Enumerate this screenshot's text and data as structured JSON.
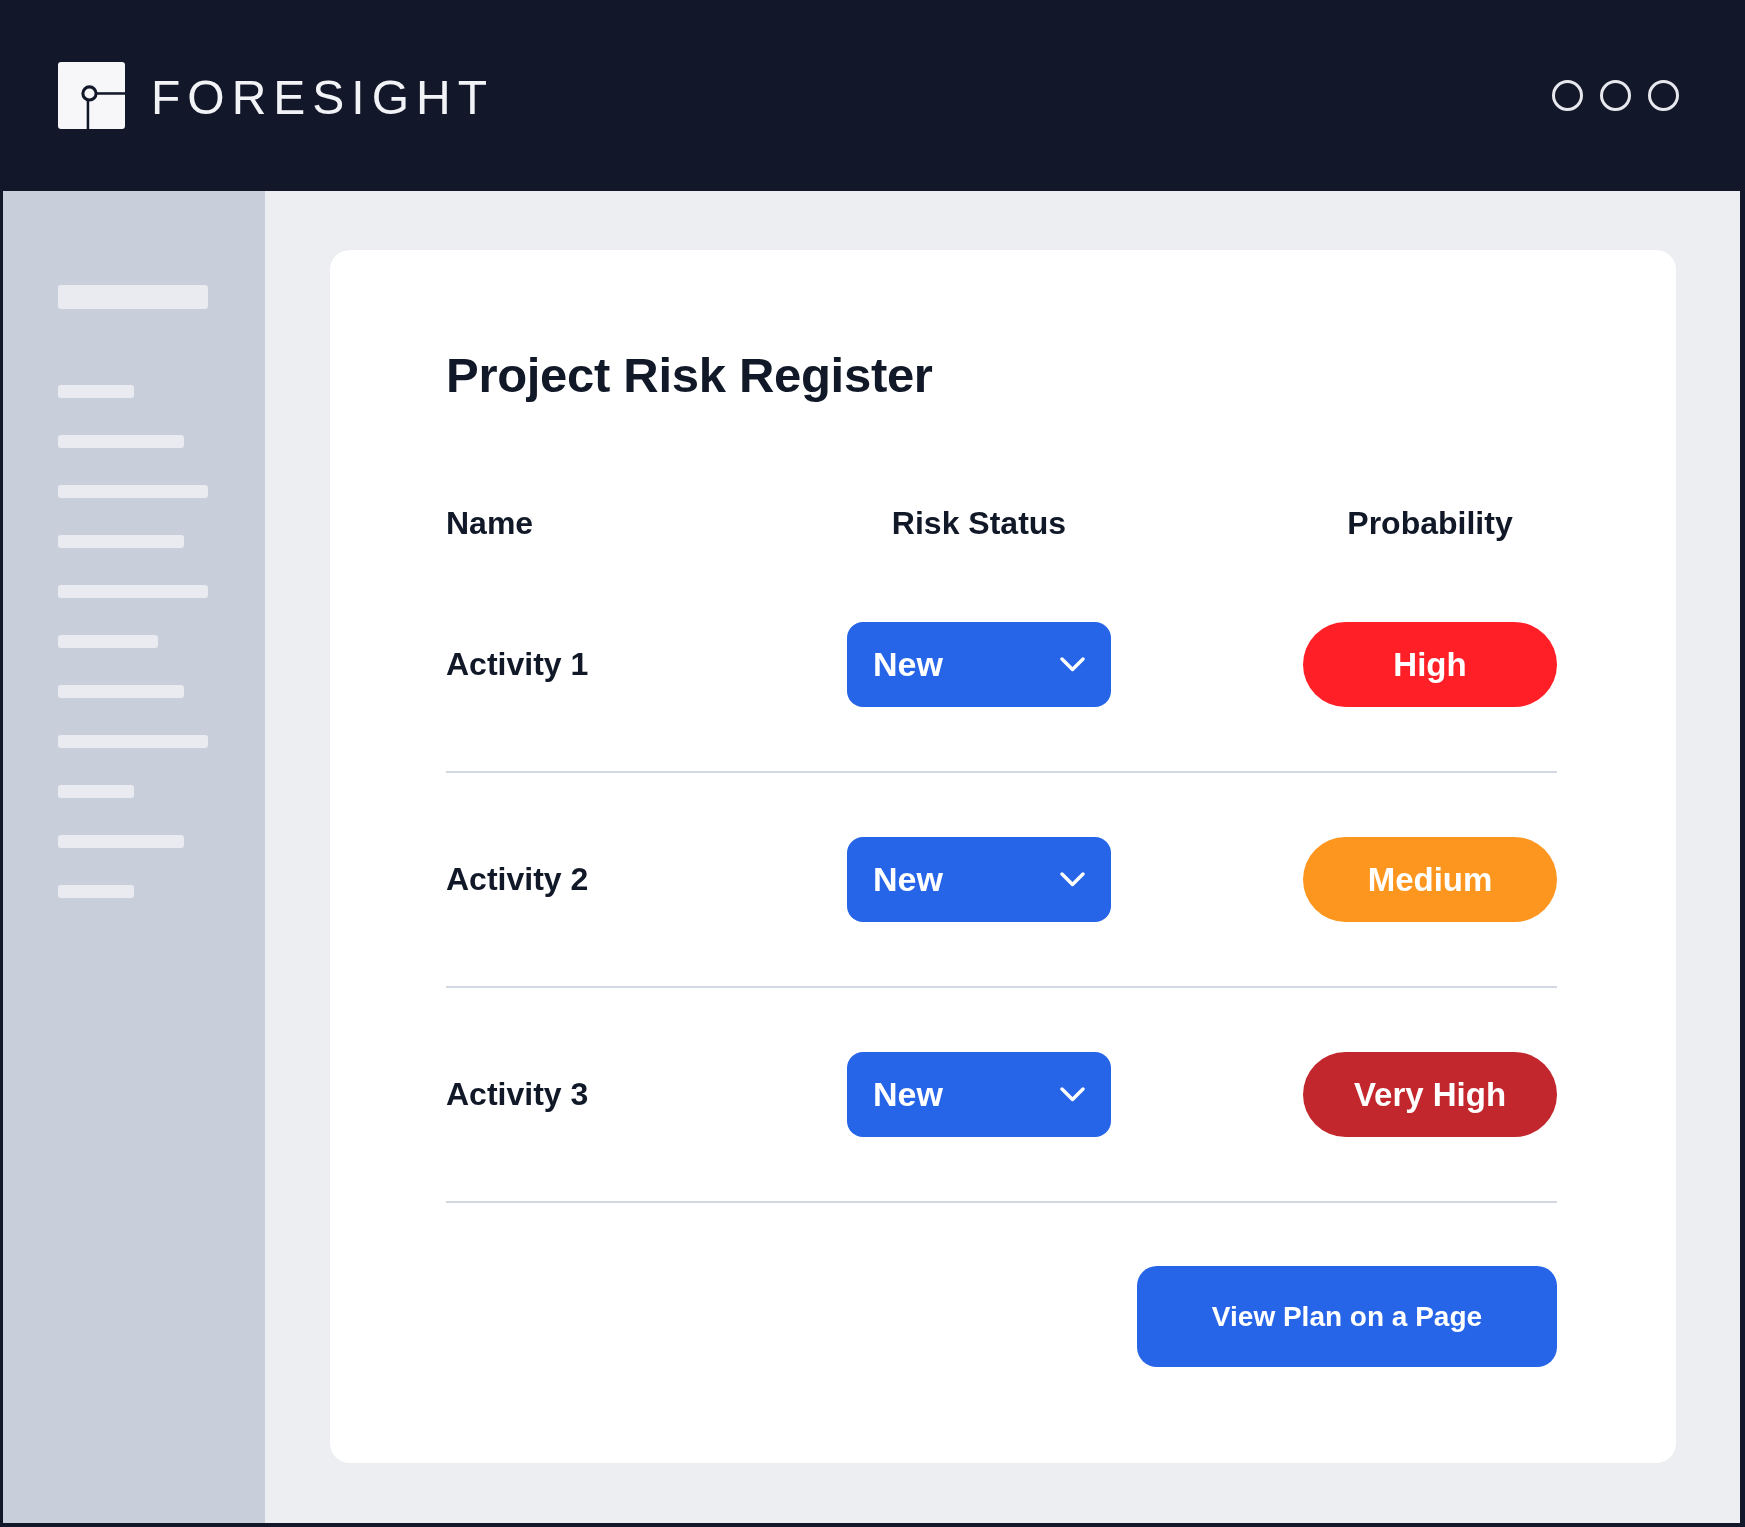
{
  "header": {
    "logo_text": "FORESIGHT"
  },
  "page": {
    "title": "Project Risk Register"
  },
  "table": {
    "columns": [
      "Name",
      "Risk Status",
      "Probability"
    ],
    "rows": [
      {
        "name": "Activity 1",
        "status": "New",
        "probability": {
          "label": "High",
          "color": "#ff1f27"
        }
      },
      {
        "name": "Activity 2",
        "status": "New",
        "probability": {
          "label": "Medium",
          "color": "#fd961e"
        }
      },
      {
        "name": "Activity 3",
        "status": "New",
        "probability": {
          "label": "Very High",
          "color": "#c1272d"
        }
      }
    ]
  },
  "actions": {
    "primary_button": "View Plan on a Page"
  }
}
